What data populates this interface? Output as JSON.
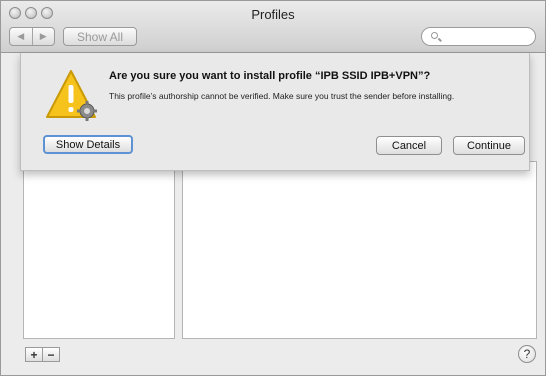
{
  "window": {
    "title": "Profiles"
  },
  "toolbar": {
    "back_glyph": "◀",
    "forward_glyph": "▶",
    "show_all_label": "Show All",
    "search_placeholder": ""
  },
  "sheet": {
    "title": "Are you sure you want to install profile “IPB SSID IPB+VPN”?",
    "message": "This profile’s authorship cannot be verified. Make sure you trust the sender before installing.",
    "show_details_label": "Show Details",
    "cancel_label": "Cancel",
    "continue_label": "Continue",
    "icon": "warning-icon"
  },
  "bottom": {
    "add_label": "+",
    "remove_label": "−",
    "help_label": "?"
  },
  "colors": {
    "warning_yellow": "#f6c21c",
    "focus_ring": "#5d93d4"
  }
}
